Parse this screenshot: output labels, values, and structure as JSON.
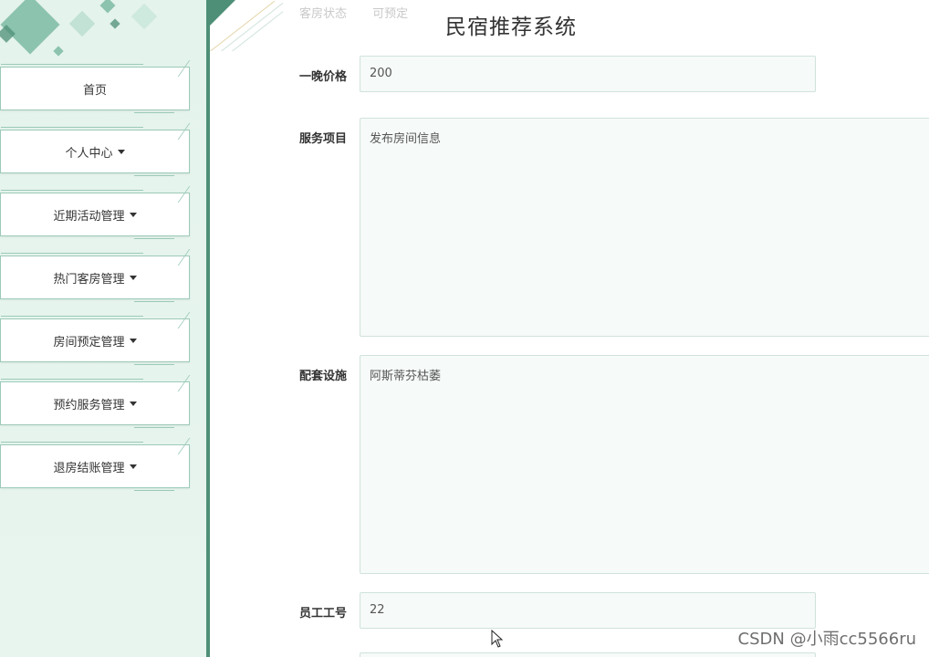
{
  "app": {
    "title": "民宿推荐系统"
  },
  "header": {
    "faded_label": "客房状态",
    "faded_value": "可预定"
  },
  "sidebar": {
    "items": [
      {
        "label": "首页",
        "dropdown": false
      },
      {
        "label": "个人中心",
        "dropdown": true
      },
      {
        "label": "近期活动管理",
        "dropdown": true
      },
      {
        "label": "热门客房管理",
        "dropdown": true
      },
      {
        "label": "房间预定管理",
        "dropdown": true
      },
      {
        "label": "预约服务管理",
        "dropdown": true
      },
      {
        "label": "退房结账管理",
        "dropdown": true
      }
    ]
  },
  "form": {
    "price": {
      "label": "一晚价格",
      "value": "200"
    },
    "services": {
      "label": "服务项目",
      "value": "发布房间信息"
    },
    "facilities": {
      "label": "配套设施",
      "value": "阿斯蒂芬枯萎"
    },
    "employee_id": {
      "label": "员工工号",
      "value": "22"
    }
  },
  "watermark": "CSDN @小雨cc5566ru",
  "colors": {
    "accent": "#4e8f77",
    "sidebar_bg": "#e4f3ec",
    "border": "#9ccab8"
  }
}
